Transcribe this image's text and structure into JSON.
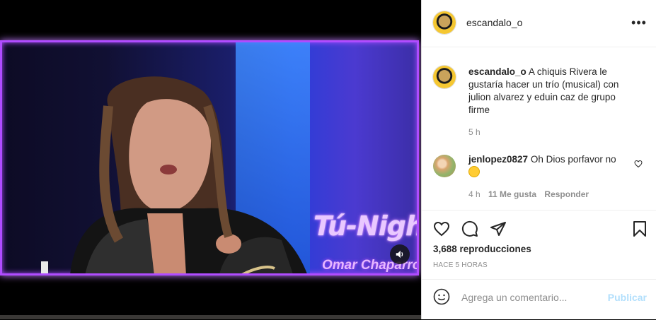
{
  "video": {
    "overlay_title": "Tú-Night",
    "overlay_subtitle": "Omar Chaparro",
    "sound_icon": "speaker-icon"
  },
  "post": {
    "username": "escandalo_o",
    "more_icon": "more-options-icon"
  },
  "caption": {
    "username": "escandalo_o",
    "text": "A chiquis Rivera le gustaría hacer un trío (musical) con julion alvarez y eduin caz de grupo firme",
    "time": "5 h"
  },
  "comment": {
    "username": "jenlopez0827",
    "text": "Oh Dios porfavor no",
    "emoji": "grinning-sweat-emoji",
    "time": "4 h",
    "likes": "11 Me gusta",
    "reply_label": "Responder"
  },
  "stats": {
    "views": "3,688 reproducciones",
    "posted": "HACE 5 HORAS"
  },
  "add_comment": {
    "placeholder": "Agrega un comentario...",
    "publish_label": "Publicar"
  }
}
